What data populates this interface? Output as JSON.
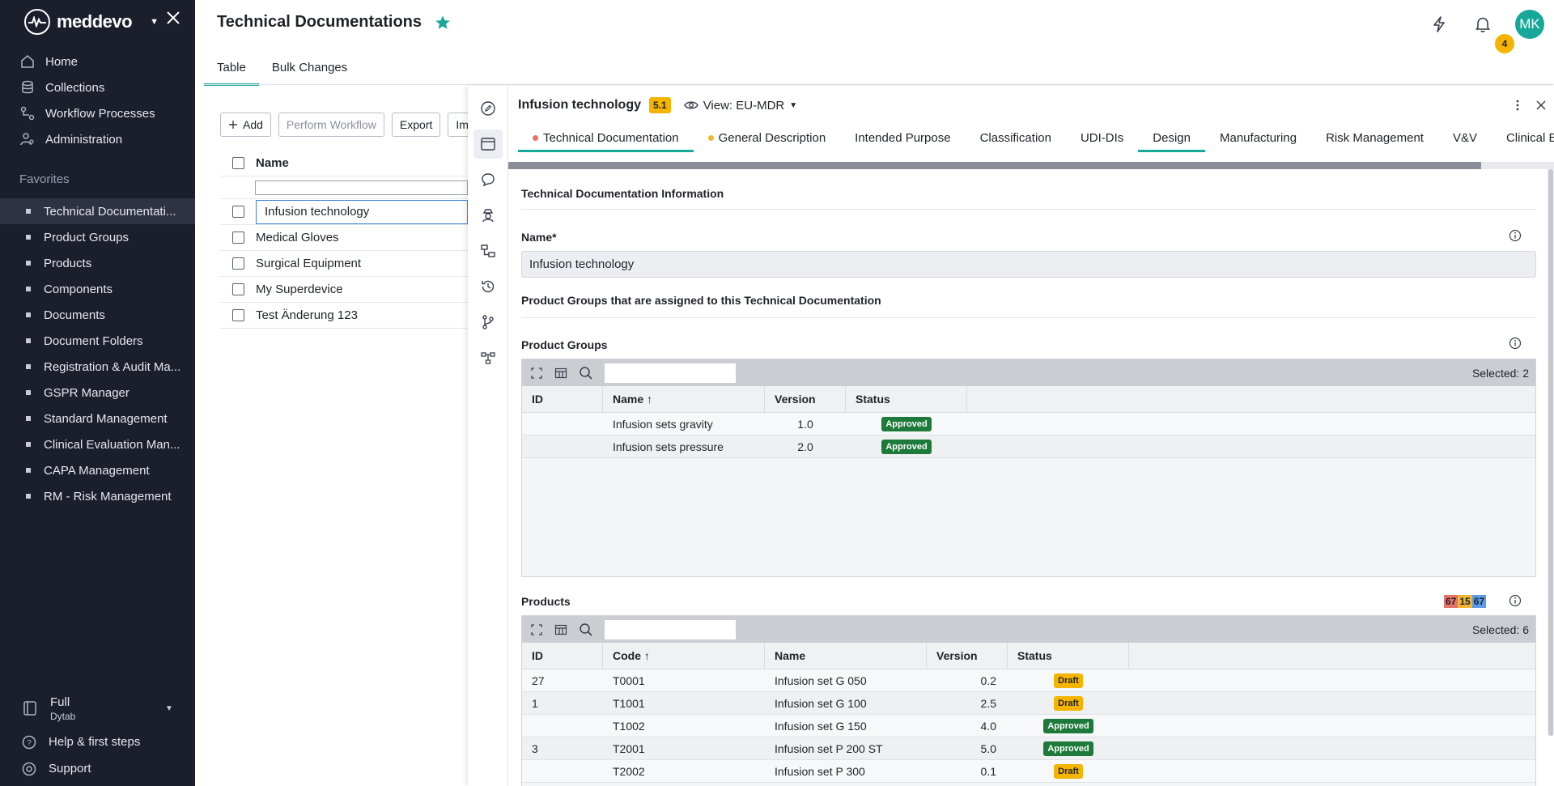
{
  "app": {
    "logo_text": "meddevo",
    "colors": {
      "accent": "#17a89a",
      "sidebar_bg": "#1b1e2b",
      "warning": "#f5b400",
      "approved": "#1d7a3a"
    }
  },
  "sidebar": {
    "nav": [
      {
        "label": "Home",
        "icon": "home-icon"
      },
      {
        "label": "Collections",
        "icon": "database-icon"
      },
      {
        "label": "Workflow Processes",
        "icon": "workflow-icon"
      },
      {
        "label": "Administration",
        "icon": "admin-users-icon"
      }
    ],
    "favorites_title": "Favorites",
    "favorites": [
      "Technical Documentati...",
      "Product Groups",
      "Products",
      "Components",
      "Documents",
      "Document Folders",
      "Registration & Audit Ma...",
      "GSPR Manager",
      "Standard Management",
      "Clinical Evaluation Man...",
      "CAPA Management",
      "RM - Risk Management"
    ],
    "plan_name": "Full",
    "plan_sub": "Dytab",
    "help": "Help & first steps",
    "support": "Support"
  },
  "header": {
    "title": "Technical Documentations",
    "notifications_count": "4",
    "avatar_initials": "MK",
    "tabs": [
      "Table",
      "Bulk Changes"
    ]
  },
  "list": {
    "toolbar": {
      "add": "Add",
      "perform_workflow": "Perform Workflow",
      "export": "Export",
      "import": "Imp"
    },
    "column_name": "Name",
    "rows": [
      "Infusion technology",
      "Medical Gloves",
      "Surgical Equipment",
      "My Superdevice",
      "Test Änderung 123"
    ]
  },
  "panel": {
    "title": "Infusion technology",
    "version": "5.1",
    "view": "View: EU-MDR",
    "tabs": [
      {
        "label": "Technical Documentation",
        "dot": "#e5736b"
      },
      {
        "label": "General Description",
        "dot": "#f2b632"
      },
      {
        "label": "Intended Purpose",
        "dot": ""
      },
      {
        "label": "Classification",
        "dot": ""
      },
      {
        "label": "UDI-DIs",
        "dot": ""
      },
      {
        "label": "Design",
        "dot": ""
      },
      {
        "label": "Manufacturing",
        "dot": ""
      },
      {
        "label": "Risk Management",
        "dot": ""
      },
      {
        "label": "V&V",
        "dot": ""
      },
      {
        "label": "Clinical Evaluation",
        "dot": ""
      }
    ],
    "section_info": "Technical Documentation Information",
    "name_label": "Name*",
    "name_value": "Infusion technology",
    "section_pg": "Product Groups that are assigned to this Technical Documentation",
    "product_groups": {
      "label": "Product Groups",
      "selected": "Selected: 2",
      "columns": [
        "ID",
        "Name ↑",
        "Version",
        "Status"
      ],
      "rows": [
        {
          "id": "",
          "name": "Infusion sets gravity",
          "version": "1.0",
          "status": "Approved"
        },
        {
          "id": "",
          "name": "Infusion sets pressure",
          "version": "2.0",
          "status": "Approved"
        }
      ]
    },
    "products": {
      "label": "Products",
      "counters": [
        "67",
        "15",
        "67"
      ],
      "selected": "Selected: 6",
      "columns": [
        "ID",
        "Code ↑",
        "Name",
        "Version",
        "Status"
      ],
      "rows": [
        {
          "id": "27",
          "code": "T0001",
          "name": "Infusion set G 050",
          "version": "0.2",
          "status": "Draft"
        },
        {
          "id": "1",
          "code": "T1001",
          "name": "Infusion set G 100",
          "version": "2.5",
          "status": "Draft"
        },
        {
          "id": "",
          "code": "T1002",
          "name": "Infusion set G 150",
          "version": "4.0",
          "status": "Approved"
        },
        {
          "id": "3",
          "code": "T2001",
          "name": "Infusion set P 200 ST",
          "version": "5.0",
          "status": "Approved"
        },
        {
          "id": "",
          "code": "T2002",
          "name": "Infusion set P 300",
          "version": "0.1",
          "status": "Draft"
        }
      ]
    }
  }
}
